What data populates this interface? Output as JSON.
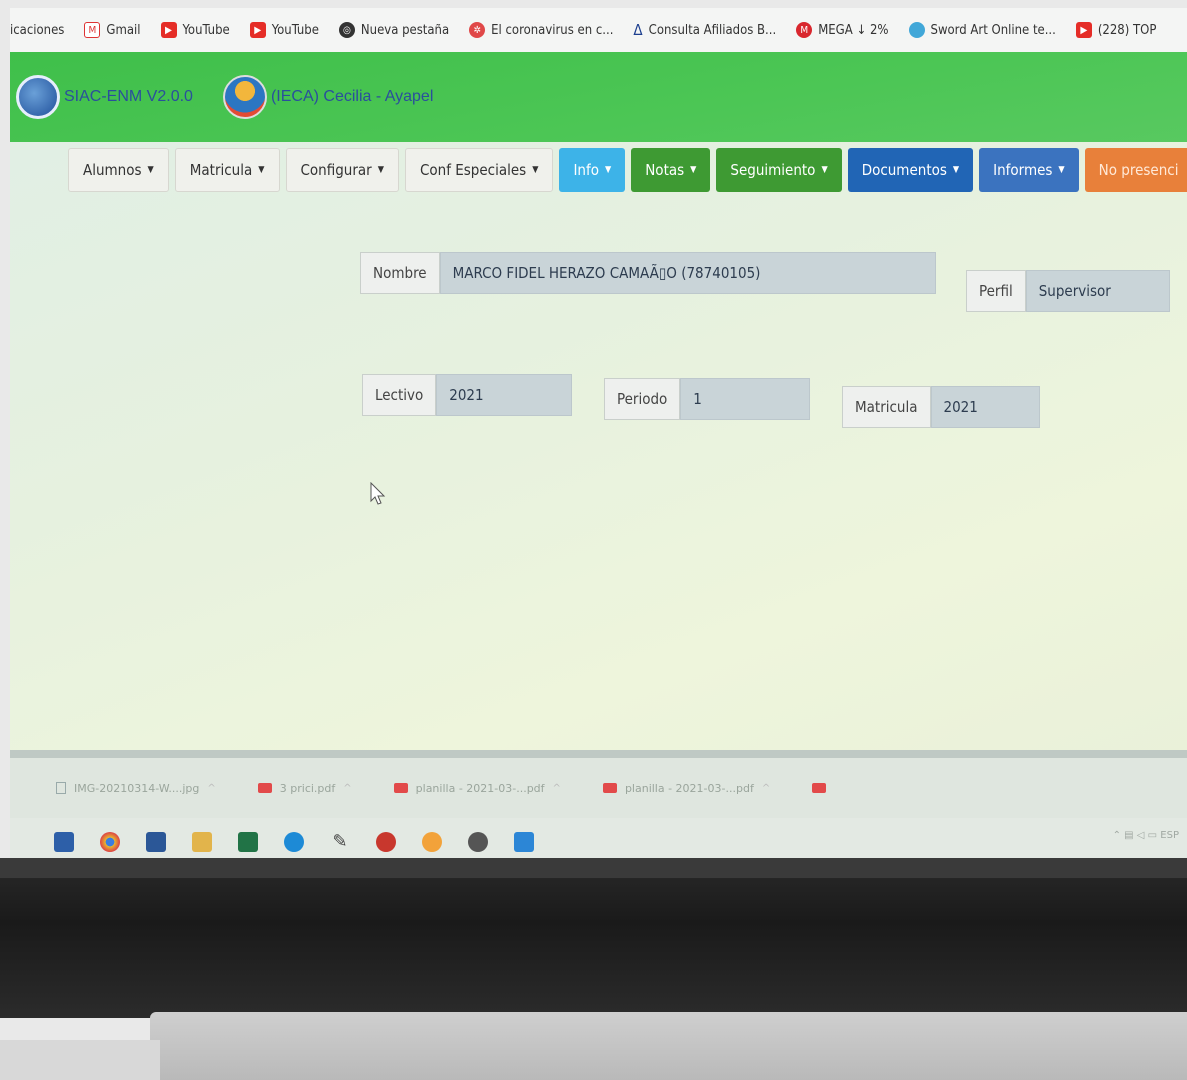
{
  "bookmarks": {
    "items": [
      {
        "label": "icaciones",
        "icon": "apps-icon"
      },
      {
        "label": "Gmail",
        "icon": "gmail-icon"
      },
      {
        "label": "YouTube",
        "icon": "youtube-icon"
      },
      {
        "label": "YouTube",
        "icon": "youtube-icon"
      },
      {
        "label": "Nueva pestaña",
        "icon": "globe-icon"
      },
      {
        "label": "El coronavirus en c...",
        "icon": "virus-icon"
      },
      {
        "label": "Consulta Afiliados B...",
        "icon": "triangle-icon"
      },
      {
        "label": "MEGA ↓ 2%",
        "icon": "mega-icon"
      },
      {
        "label": "Sword Art Online te...",
        "icon": "blue-dot-icon"
      },
      {
        "label": "(228) TOP",
        "icon": "youtube-icon"
      }
    ]
  },
  "header": {
    "app_name": "SIAC-ENM V2.0.0",
    "school_name": "(IECA) Cecilia - Ayapel"
  },
  "nav": {
    "alumnos": "Alumnos",
    "matricula": "Matricula",
    "configurar": "Configurar",
    "conf_especiales": "Conf Especiales",
    "info": "Info",
    "notas": "Notas",
    "seguimiento": "Seguimiento",
    "documentos": "Documentos",
    "informes": "Informes",
    "no_presencial": "No presenci"
  },
  "form": {
    "nombre_label": "Nombre",
    "nombre_value": "MARCO FIDEL HERAZO CAMAÃ▯O (78740105)",
    "perfil_label": "Perfil",
    "perfil_value": "Supervisor",
    "lectivo_label": "Lectivo",
    "lectivo_value": "2021",
    "periodo_label": "Periodo",
    "periodo_value": "1",
    "matricula_label": "Matricula",
    "matricula_value": "2021"
  },
  "downloads": {
    "items": [
      {
        "label": "IMG-20210314-W....jpg"
      },
      {
        "label": "3 prici.pdf"
      },
      {
        "label": "planilla - 2021-03-...pdf"
      },
      {
        "label": "planilla - 2021-03-...pdf"
      }
    ]
  },
  "tray": {
    "lang": "ESP"
  }
}
